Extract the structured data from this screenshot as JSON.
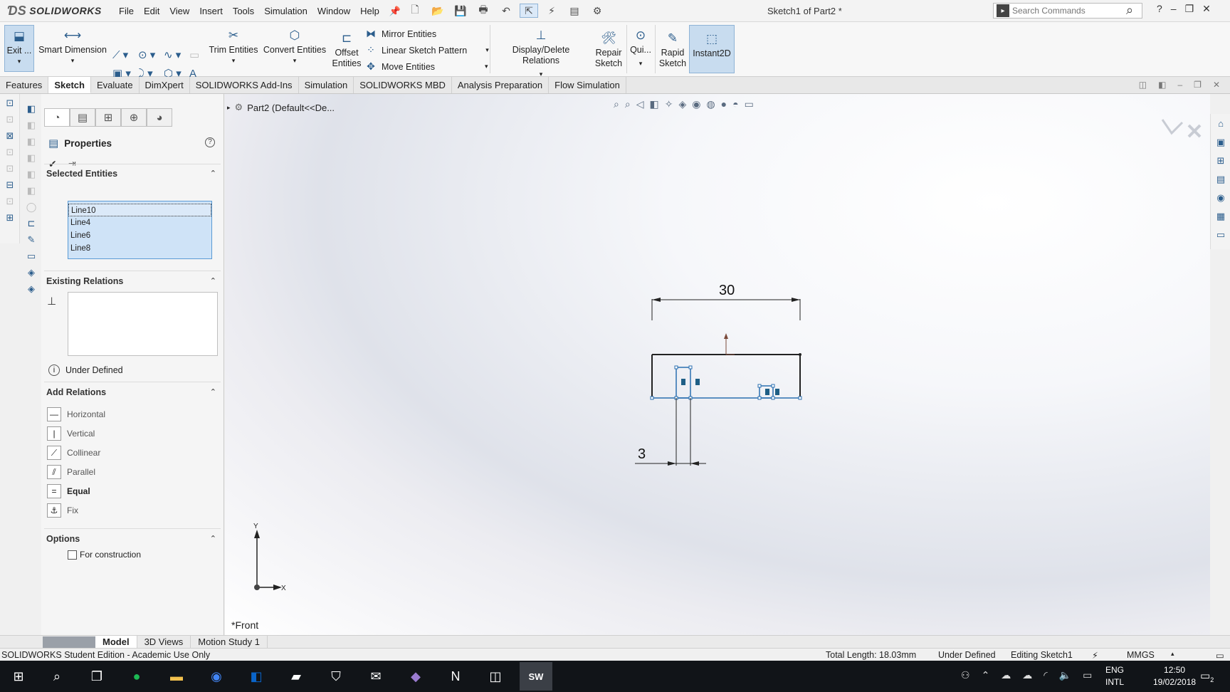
{
  "app": {
    "brand": "SOLIDWORKS",
    "doc_title": "Sketch1 of Part2 *",
    "menus": [
      "File",
      "Edit",
      "View",
      "Insert",
      "Tools",
      "Simulation",
      "Window",
      "Help"
    ]
  },
  "search": {
    "placeholder": "Search Commands"
  },
  "ribbon": {
    "exit": "Exit ...",
    "smart_dimension": "Smart Dimension",
    "trim": "Trim Entities",
    "convert": "Convert Entities",
    "offset_1": "Offset",
    "offset_2": "Entities",
    "mirror": "Mirror Entities",
    "linear_pattern": "Linear Sketch Pattern",
    "move": "Move Entities",
    "display_relations": "Display/Delete Relations",
    "repair_1": "Repair",
    "repair_2": "Sketch",
    "quick": "Qui...",
    "rapid_1": "Rapid",
    "rapid_2": "Sketch",
    "instant2d": "Instant2D"
  },
  "tabs": [
    "Features",
    "Sketch",
    "Evaluate",
    "DimXpert",
    "SOLIDWORKS Add-Ins",
    "Simulation",
    "SOLIDWORKS MBD",
    "Analysis Preparation",
    "Flow Simulation"
  ],
  "pm": {
    "title": "Properties",
    "selected_title": "Selected Entities",
    "selected": [
      "Line10",
      "Line4",
      "Line6",
      "Line8"
    ],
    "existing_title": "Existing Relations",
    "status": "Under Defined",
    "add_title": "Add Relations",
    "relations": [
      "Horizontal",
      "Vertical",
      "Collinear",
      "Parallel",
      "Equal",
      "Fix"
    ],
    "options_title": "Options",
    "construction": "For construction"
  },
  "tree": {
    "root": "Part2  (Default<<De..."
  },
  "sketch": {
    "dim_width": "30",
    "dim_slot": "3",
    "axis_y": "Y",
    "axis_x": "X"
  },
  "view_label": "*Front",
  "bottom_tabs": [
    "Model",
    "3D Views",
    "Motion Study 1"
  ],
  "status": {
    "edition": "SOLIDWORKS Student Edition - Academic Use Only",
    "total_length": "Total Length: 18.03mm",
    "defined": "Under Defined",
    "editing": "Editing Sketch1",
    "units": "MMGS"
  },
  "taskbar": {
    "lang_1": "ENG",
    "lang_2": "INTL",
    "time": "12:50",
    "date": "19/02/2018",
    "notif_count": "2",
    "sw_label": "SW"
  }
}
